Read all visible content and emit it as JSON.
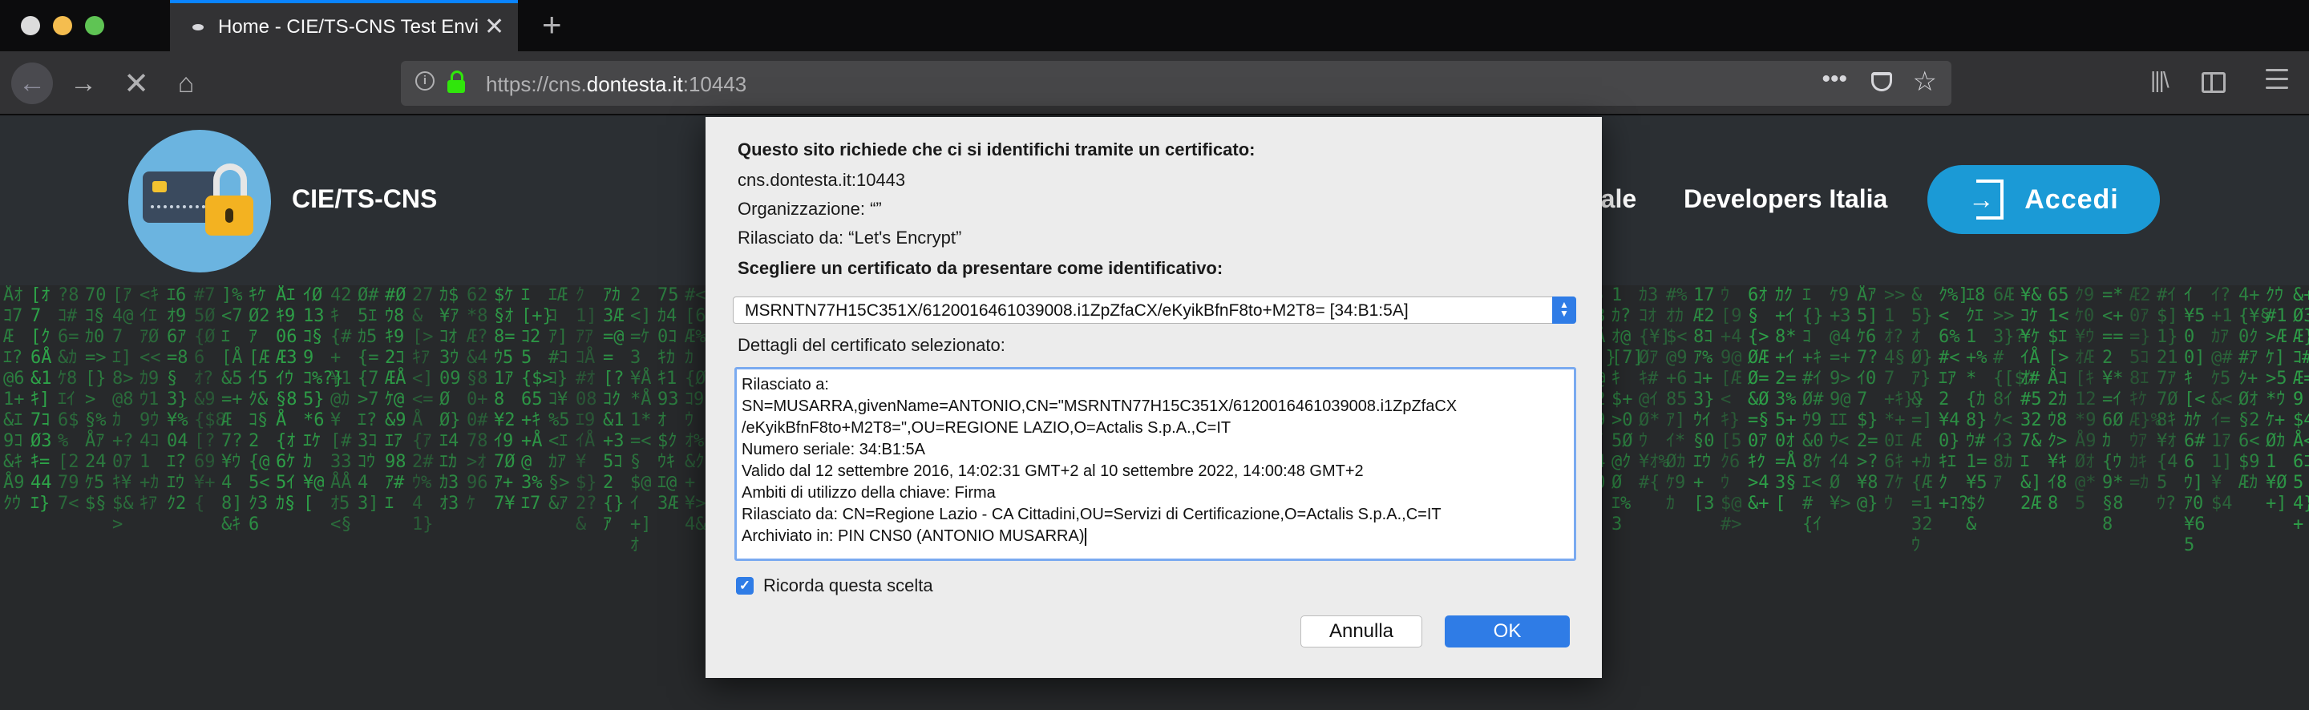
{
  "browser": {
    "tab_title": "Home - CIE/TS-CNS Test Environment",
    "url_prefix": "https://cns.",
    "url_domain": "dontesta.it",
    "url_suffix": ":10443",
    "url_more": "•••",
    "new_tab": "+",
    "tab_close": "✕"
  },
  "site": {
    "title": "CIE/TS-CNS",
    "nav_partial": "tale",
    "nav_developers": "Developers Italia",
    "login_label": "Accedi"
  },
  "dialog": {
    "heading": "Questo sito richiede che ci si identifichi tramite un certificato:",
    "host": "cns.dontesta.it:10443",
    "organization": "Organizzazione: “”",
    "issued_by": "Rilasciato da: “Let's Encrypt”",
    "choose_label": "Scegliere un certificato da presentare come identificativo:",
    "selected_certificate": "MSRNTN77H15C351X/6120016461039008.i1ZpZfaCX/eKyikBfnF8to+M2T8= [34:B1:5A]",
    "details_label": "Dettagli del certificato selezionato:",
    "details_lines": [
      "Rilasciato a:",
      "SN=MUSARRA,givenName=ANTONIO,CN=\"MSRNTN77H15C351X/6120016461039008.i1ZpZfaCX",
      "/eKyikBfnF8to+M2T8=\",OU=REGIONE LAZIO,O=Actalis S.p.A.,C=IT",
      "Numero seriale: 34:B1:5A",
      "Valido dal 12 settembre 2016, 14:02:31 GMT+2 al 10 settembre 2022, 14:00:48 GMT+2",
      "Ambiti di utilizzo della chiave: Firma",
      "Rilasciato da: CN=Regione Lazio - CA Cittadini,OU=Servizi di Certificazione,O=Actalis S.p.A.,C=IT",
      "Archiviato in: PIN CNS0 (ANTONIO MUSARRA)"
    ],
    "remember_label": "Ricorda questa scelta",
    "remember_checked": true,
    "cancel_label": "Annulla",
    "ok_label": "OK"
  },
  "colors": {
    "accent": "#2f7ce6",
    "site_button": "#1b9ad6",
    "matrix_green": "#2ea84a",
    "tab_highlight": "#0a84ff"
  },
  "icons": [
    "back-arrow-icon",
    "forward-arrow-icon",
    "stop-icon",
    "home-icon",
    "info-icon",
    "lock-icon",
    "page-actions-icon",
    "pocket-icon",
    "bookmark-star-icon",
    "library-icon",
    "sidebar-icon",
    "menu-icon",
    "padlock-card-logo",
    "login-icon",
    "checkmark-icon",
    "select-arrows-icon"
  ]
}
